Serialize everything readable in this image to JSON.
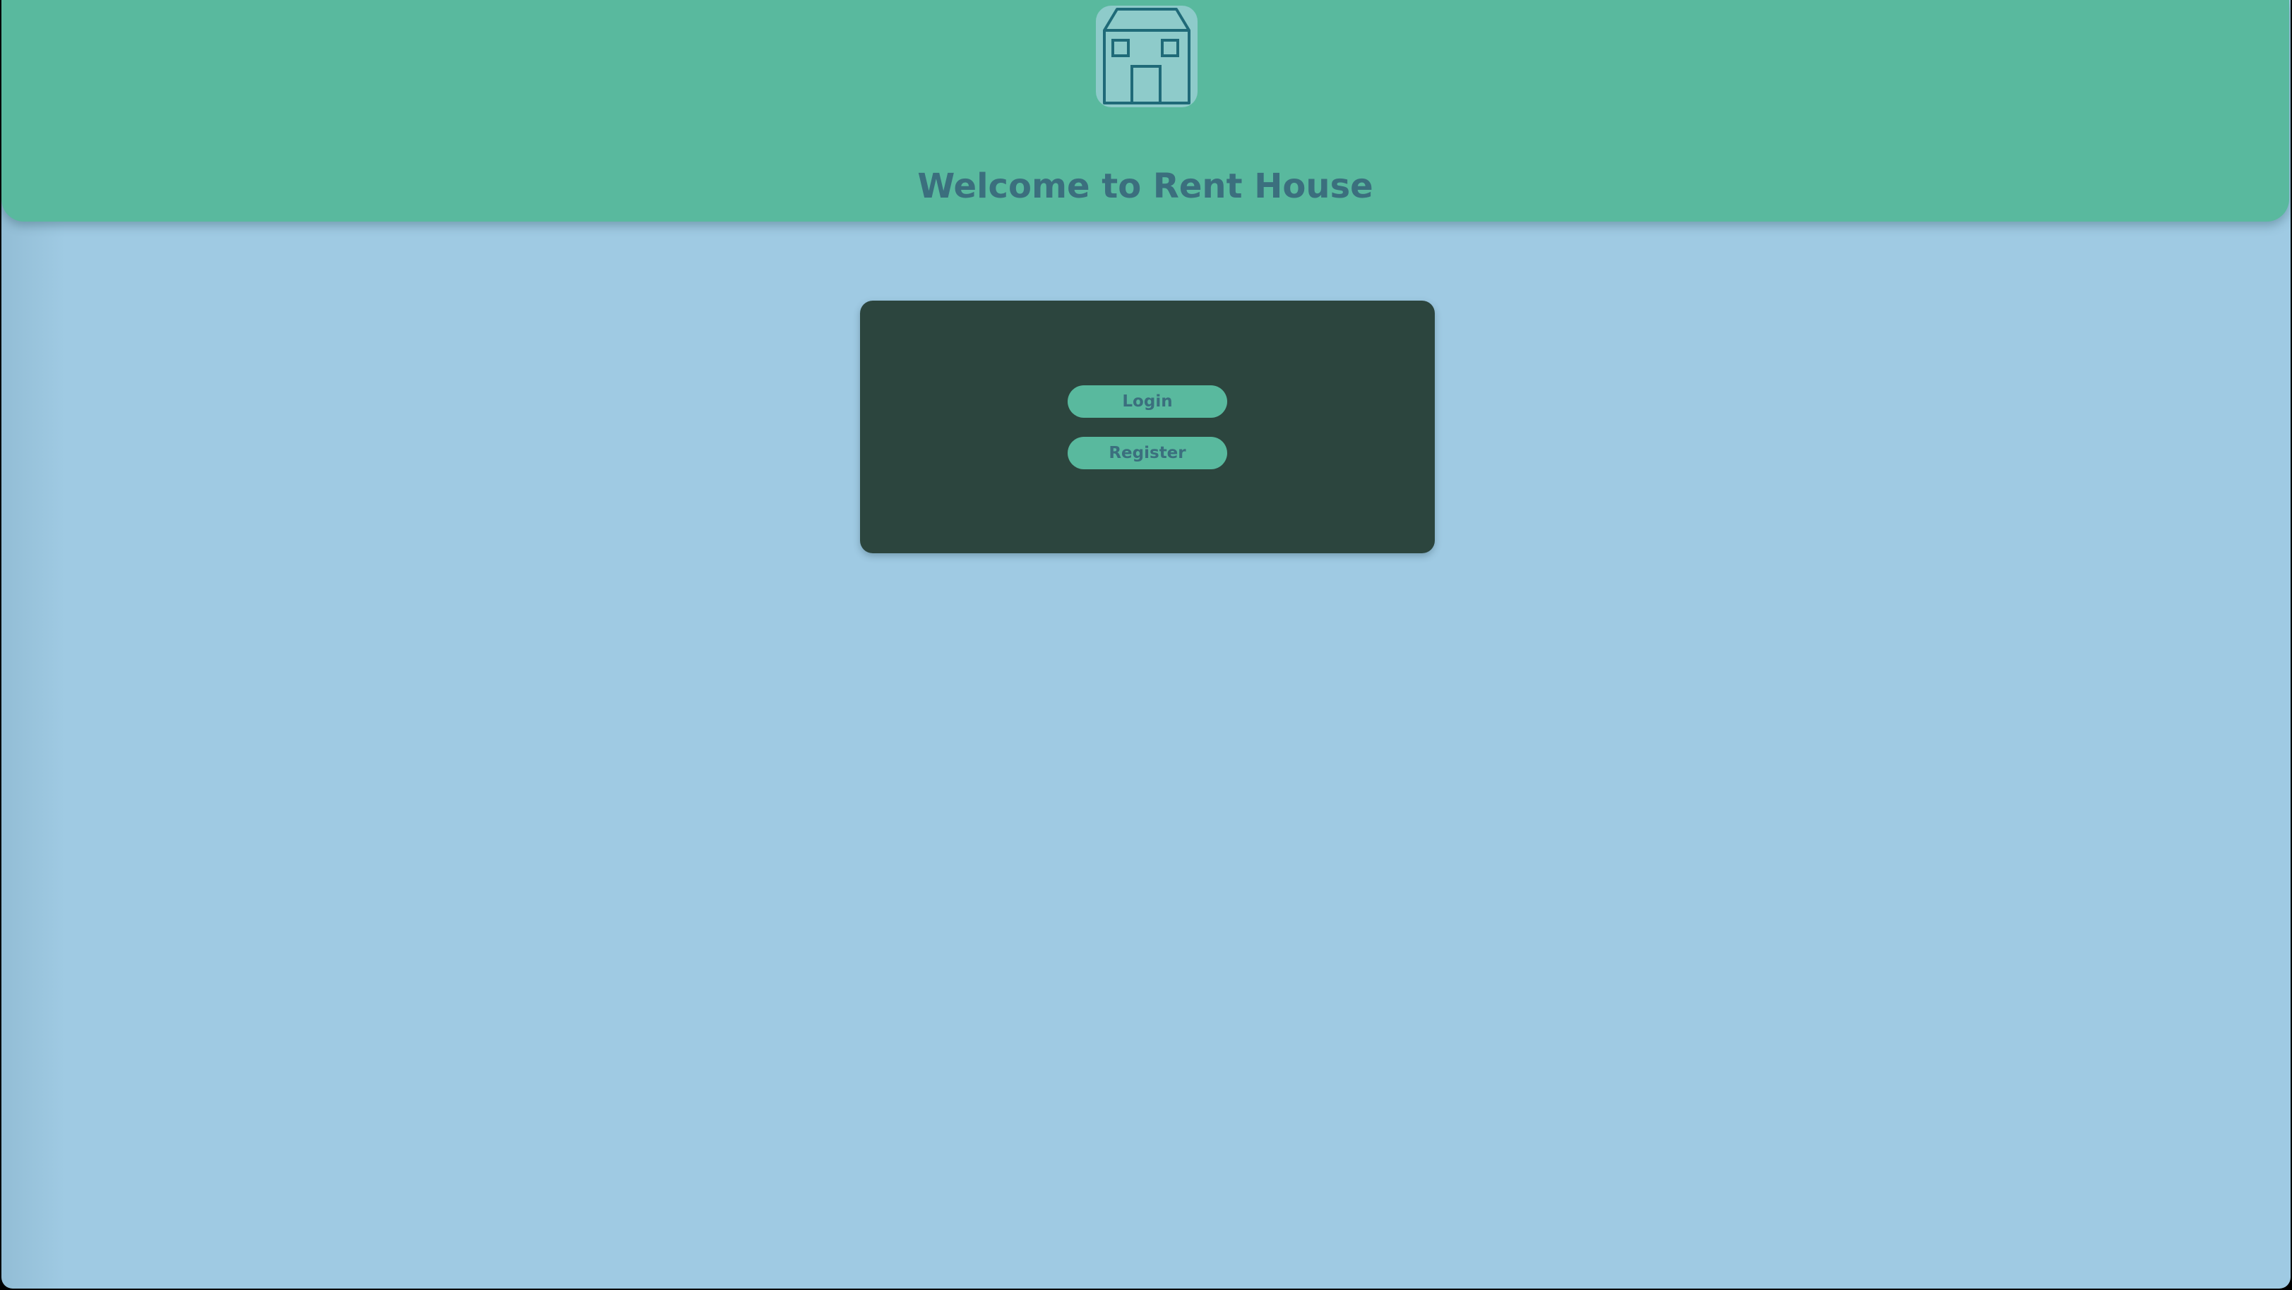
{
  "header": {
    "logo_icon": "house-icon",
    "title": "Welcome to Rent House"
  },
  "auth_card": {
    "login_label": "Login",
    "register_label": "Register"
  },
  "colors": {
    "page_background": "#9fcae3",
    "header_background": "#59b99e",
    "card_background": "#2c453e",
    "button_background": "#59b99e",
    "text_accent": "#3b6f7e",
    "logo_stroke": "#1f6a78",
    "logo_background": "#8ecbca"
  }
}
